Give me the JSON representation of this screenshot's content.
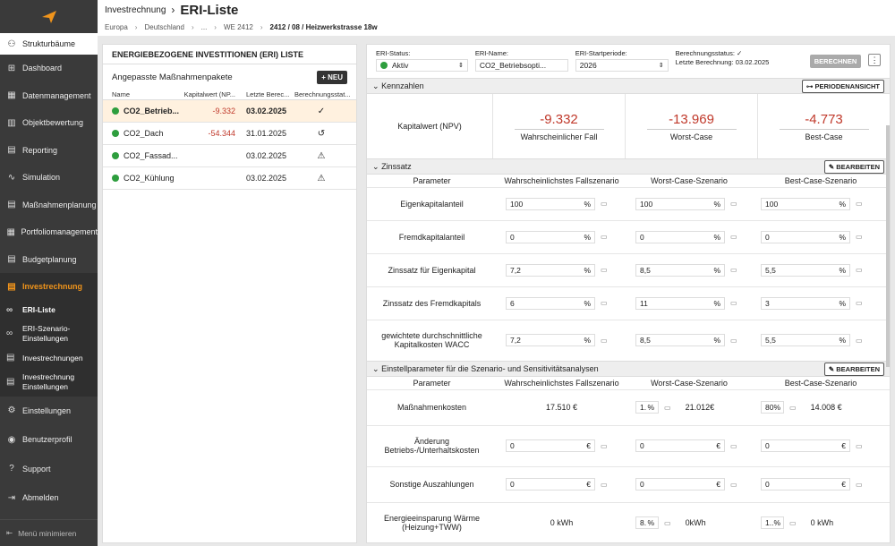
{
  "header": {
    "parent": "Investrechnung",
    "title": "ERI-Liste",
    "breadcrumb": [
      "Europa",
      "Deutschland",
      "...",
      "WE 2412"
    ],
    "breadcrumb_current": "2412 / 08 / Heizwerkstrasse 18w"
  },
  "sidebar": {
    "struct": "Strukturbäume",
    "items": [
      "Dashboard",
      "Datenmanagement",
      "Objektbewertung",
      "Reporting",
      "Simulation",
      "Maßnahmenplanung",
      "Portfoliomanagement",
      "Budgetplanung"
    ],
    "active": "Investrechnung",
    "sub": [
      "ERI-Liste",
      "ERI-Szenario-Einstellungen",
      "Investrechnungen",
      "Investrechnung Einstellungen"
    ],
    "bottom_items": [
      "Einstellungen",
      "Benutzerprofil",
      "Support",
      "Abmelden"
    ],
    "minimize": "Menü minimieren"
  },
  "left": {
    "title": "ENERGIEBEZOGENE INVESTITIONEN (ERI) LISTE",
    "subtitle": "Angepasste Maßnahmenpakete",
    "new_label": "NEU",
    "columns": [
      "Name",
      "Kapitalwert (NP...",
      "Letzte Berec...",
      "Berechnungsstat..."
    ],
    "rows": [
      {
        "name": "CO2_Betrieb...",
        "npv": "-9.332",
        "date": "03.02.2025",
        "status": "✓"
      },
      {
        "name": "CO2_Dach",
        "npv": "-54.344",
        "date": "31.01.2025",
        "status": "↺"
      },
      {
        "name": "CO2_Fassad...",
        "npv": "",
        "date": "03.02.2025",
        "status": "⚠"
      },
      {
        "name": "CO2_Kühlung",
        "npv": "",
        "date": "03.02.2025",
        "status": "⚠"
      }
    ]
  },
  "status": {
    "eri_status_label": "ERI-Status:",
    "eri_status": "Aktiv",
    "eri_name_label": "ERI-Name:",
    "eri_name": "CO2_Betriebsopti...",
    "start_label": "ERI-Startperiode:",
    "start": "2026",
    "calc_label": "Berechnungsstatus:",
    "calc_check": "✓",
    "last_calc": "Letzte Berechnung: 03.02.2025",
    "calc_button": "BERECHNEN"
  },
  "kennzahlen": {
    "title": "Kennzahlen",
    "button": "PERIODENANSICHT",
    "label": "Kapitalwert (NPV)",
    "values": [
      {
        "v": "-9.332",
        "c": "Wahrscheinlicher Fall"
      },
      {
        "v": "-13.969",
        "c": "Worst-Case"
      },
      {
        "v": "-4.773",
        "c": "Best-Case"
      }
    ]
  },
  "zinssatz": {
    "title": "Zinssatz",
    "button": "BEARBEITEN",
    "headers": [
      "Parameter",
      "Wahrscheinlichstes Fallszenario",
      "Worst-Case-Szenario",
      "Best-Case-Szenario"
    ],
    "rows": [
      {
        "p": "Eigenkapitalanteil",
        "v": [
          "100",
          "100",
          "100"
        ]
      },
      {
        "p": "Fremdkapitalanteil",
        "v": [
          "0",
          "0",
          "0"
        ]
      },
      {
        "p": "Zinssatz für Eigenkapital",
        "v": [
          "7,2",
          "8,5",
          "5,5"
        ]
      },
      {
        "p": "Zinssatz des Fremdkapitals",
        "v": [
          "6",
          "11",
          "3"
        ]
      },
      {
        "p": "gewichtete durchschnittliche Kapitalkosten WACC",
        "v": [
          "7,2",
          "8,5",
          "5,5"
        ]
      }
    ],
    "unit": "%"
  },
  "einstell": {
    "title": "Einstellparameter für die Szenario- und Sensitivitätsanalysen",
    "button": "BEARBEITEN",
    "headers": [
      "Parameter",
      "Wahrscheinlichstes Fallszenario",
      "Worst-Case-Szenario",
      "Best-Case-Szenario"
    ],
    "row1": {
      "p": "Maßnahmenkosten",
      "v1": "17.510 €",
      "w_in": "1.",
      "w_val": "21.012€",
      "b_in": "80",
      "b_val": "14.008 €"
    },
    "row2": {
      "p": "Änderung Betriebs-/Unterhaltskosten",
      "v": [
        "0",
        "0",
        "0"
      ],
      "unit": "€"
    },
    "row3": {
      "p": "Sonstige Auszahlungen",
      "v": [
        "0",
        "0",
        "0"
      ],
      "unit": "€"
    },
    "row4": {
      "p": "Energieeinsparung Wärme (Heizung+TWW)",
      "v1": "0 kWh",
      "w_in": "8.",
      "w_val": "0kWh",
      "b_in": "1..",
      "b_val": "0 kWh"
    }
  }
}
